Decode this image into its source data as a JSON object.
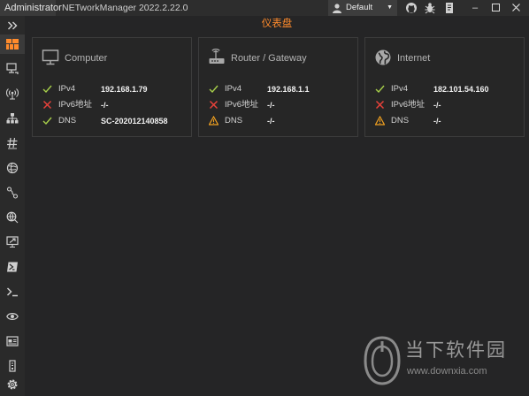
{
  "titlebar": {
    "user": "Administrator",
    "app_title": "NETworkManager 2022.2.22.0",
    "profile": "Default"
  },
  "sidebar": {
    "expand_icon": "chevron-double-right-icon",
    "items": [
      {
        "icon": "dashboard-icon",
        "active": true
      },
      {
        "icon": "network-interface-icon"
      },
      {
        "icon": "wifi-icon"
      },
      {
        "icon": "ip-scanner-icon"
      },
      {
        "icon": "port-scanner-icon"
      },
      {
        "icon": "ping-monitor-icon"
      },
      {
        "icon": "traceroute-icon"
      },
      {
        "icon": "dns-lookup-icon"
      },
      {
        "icon": "remote-desktop-icon"
      },
      {
        "icon": "powershell-icon"
      },
      {
        "icon": "putty-icon"
      },
      {
        "icon": "tigervnc-icon"
      },
      {
        "icon": "web-console-icon"
      },
      {
        "icon": "snmp-icon"
      }
    ],
    "settings_icon": "gear-icon"
  },
  "dashboard": {
    "title": "仪表盘",
    "cards": [
      {
        "title": "Computer",
        "icon": "monitor-icon",
        "rows": [
          {
            "label": "IPv4",
            "value": "192.168.1.79",
            "status": "ok"
          },
          {
            "label": "IPv6地址",
            "value": "-/-",
            "status": "error"
          },
          {
            "label": "DNS",
            "value": "SC-202012140858",
            "status": "ok"
          }
        ]
      },
      {
        "title": "Router / Gateway",
        "icon": "router-icon",
        "rows": [
          {
            "label": "IPv4",
            "value": "192.168.1.1",
            "status": "ok"
          },
          {
            "label": "IPv6地址",
            "value": "-/-",
            "status": "error"
          },
          {
            "label": "DNS",
            "value": "-/-",
            "status": "warning"
          }
        ]
      },
      {
        "title": "Internet",
        "icon": "globe-icon",
        "rows": [
          {
            "label": "IPv4",
            "value": "182.101.54.160",
            "status": "ok"
          },
          {
            "label": "IPv6地址",
            "value": "-/-",
            "status": "error"
          },
          {
            "label": "DNS",
            "value": "-/-",
            "status": "warning"
          }
        ]
      }
    ]
  },
  "watermark": {
    "text": "当下软件园",
    "url": "www.downxia.com"
  },
  "colors": {
    "accent": "#ff8b2c",
    "ok": "#a8d04a",
    "error": "#e8413a",
    "warning": "#f0a020"
  }
}
